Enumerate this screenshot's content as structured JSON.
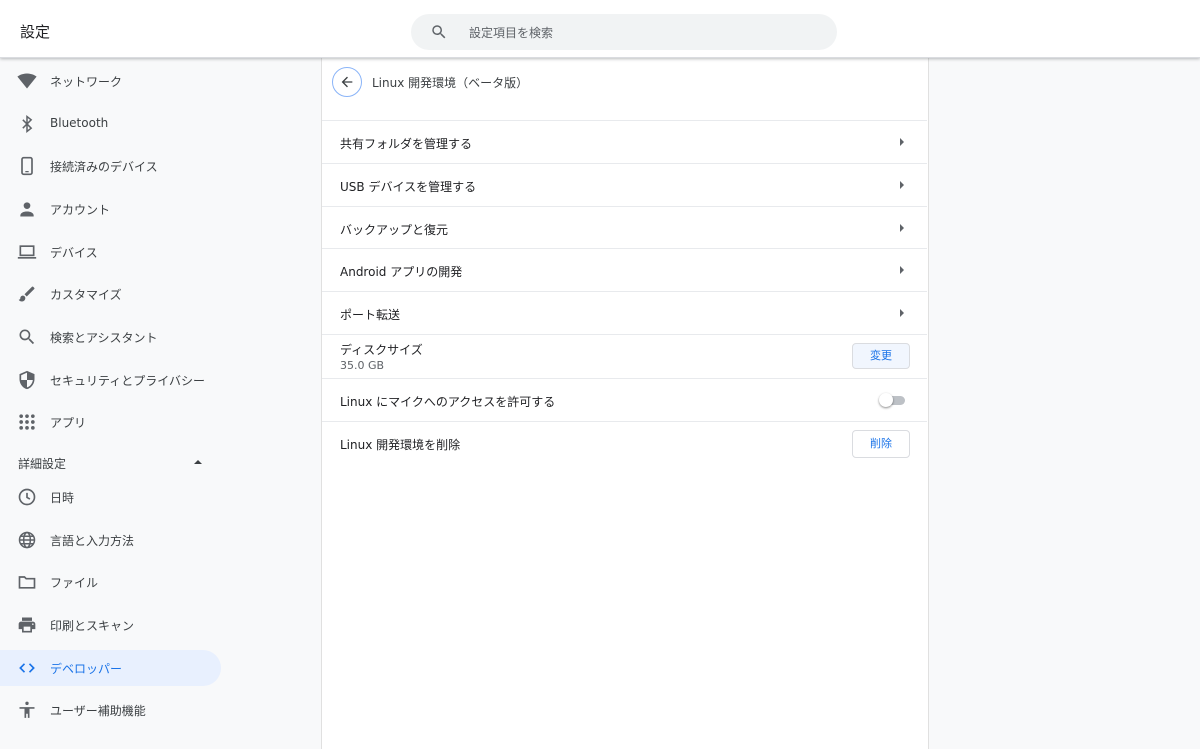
{
  "header": {
    "title": "設定",
    "search_placeholder": "設定項目を検索"
  },
  "sidebar": {
    "items": [
      {
        "label": "ネットワーク",
        "icon": "wifi-icon"
      },
      {
        "label": "Bluetooth",
        "icon": "bluetooth-icon"
      },
      {
        "label": "接続済みのデバイス",
        "icon": "phone-icon"
      },
      {
        "label": "アカウント",
        "icon": "person-icon"
      },
      {
        "label": "デバイス",
        "icon": "laptop-icon"
      },
      {
        "label": "カスタマイズ",
        "icon": "brush-icon"
      },
      {
        "label": "検索とアシスタント",
        "icon": "search-icon"
      },
      {
        "label": "セキュリティとプライバシー",
        "icon": "shield-icon"
      },
      {
        "label": "アプリ",
        "icon": "apps-grid-icon"
      }
    ],
    "advanced_label": "詳細設定",
    "advanced_items": [
      {
        "label": "日時",
        "icon": "clock-icon"
      },
      {
        "label": "言語と入力方法",
        "icon": "globe-icon"
      },
      {
        "label": "ファイル",
        "icon": "folder-icon"
      },
      {
        "label": "印刷とスキャン",
        "icon": "printer-icon"
      },
      {
        "label": "デベロッパー",
        "icon": "code-icon",
        "active": true
      },
      {
        "label": "ユーザー補助機能",
        "icon": "accessibility-icon"
      }
    ]
  },
  "main": {
    "title": "Linux 開発環境（ベータ版）",
    "rows": [
      {
        "label": "共有フォルダを管理する"
      },
      {
        "label": "USB デバイスを管理する"
      },
      {
        "label": "バックアップと復元"
      },
      {
        "label": "Android アプリの開発"
      },
      {
        "label": "ポート転送"
      }
    ],
    "disk": {
      "label": "ディスクサイズ",
      "value": "35.0 GB",
      "button": "変更"
    },
    "mic": {
      "label": "Linux にマイクへのアクセスを許可する",
      "enabled": false
    },
    "remove": {
      "label": "Linux 開発環境を削除",
      "button": "削除"
    }
  },
  "colors": {
    "accent": "#1a73e8",
    "active_bg": "#e8f0fe",
    "icon": "#5f6368"
  }
}
